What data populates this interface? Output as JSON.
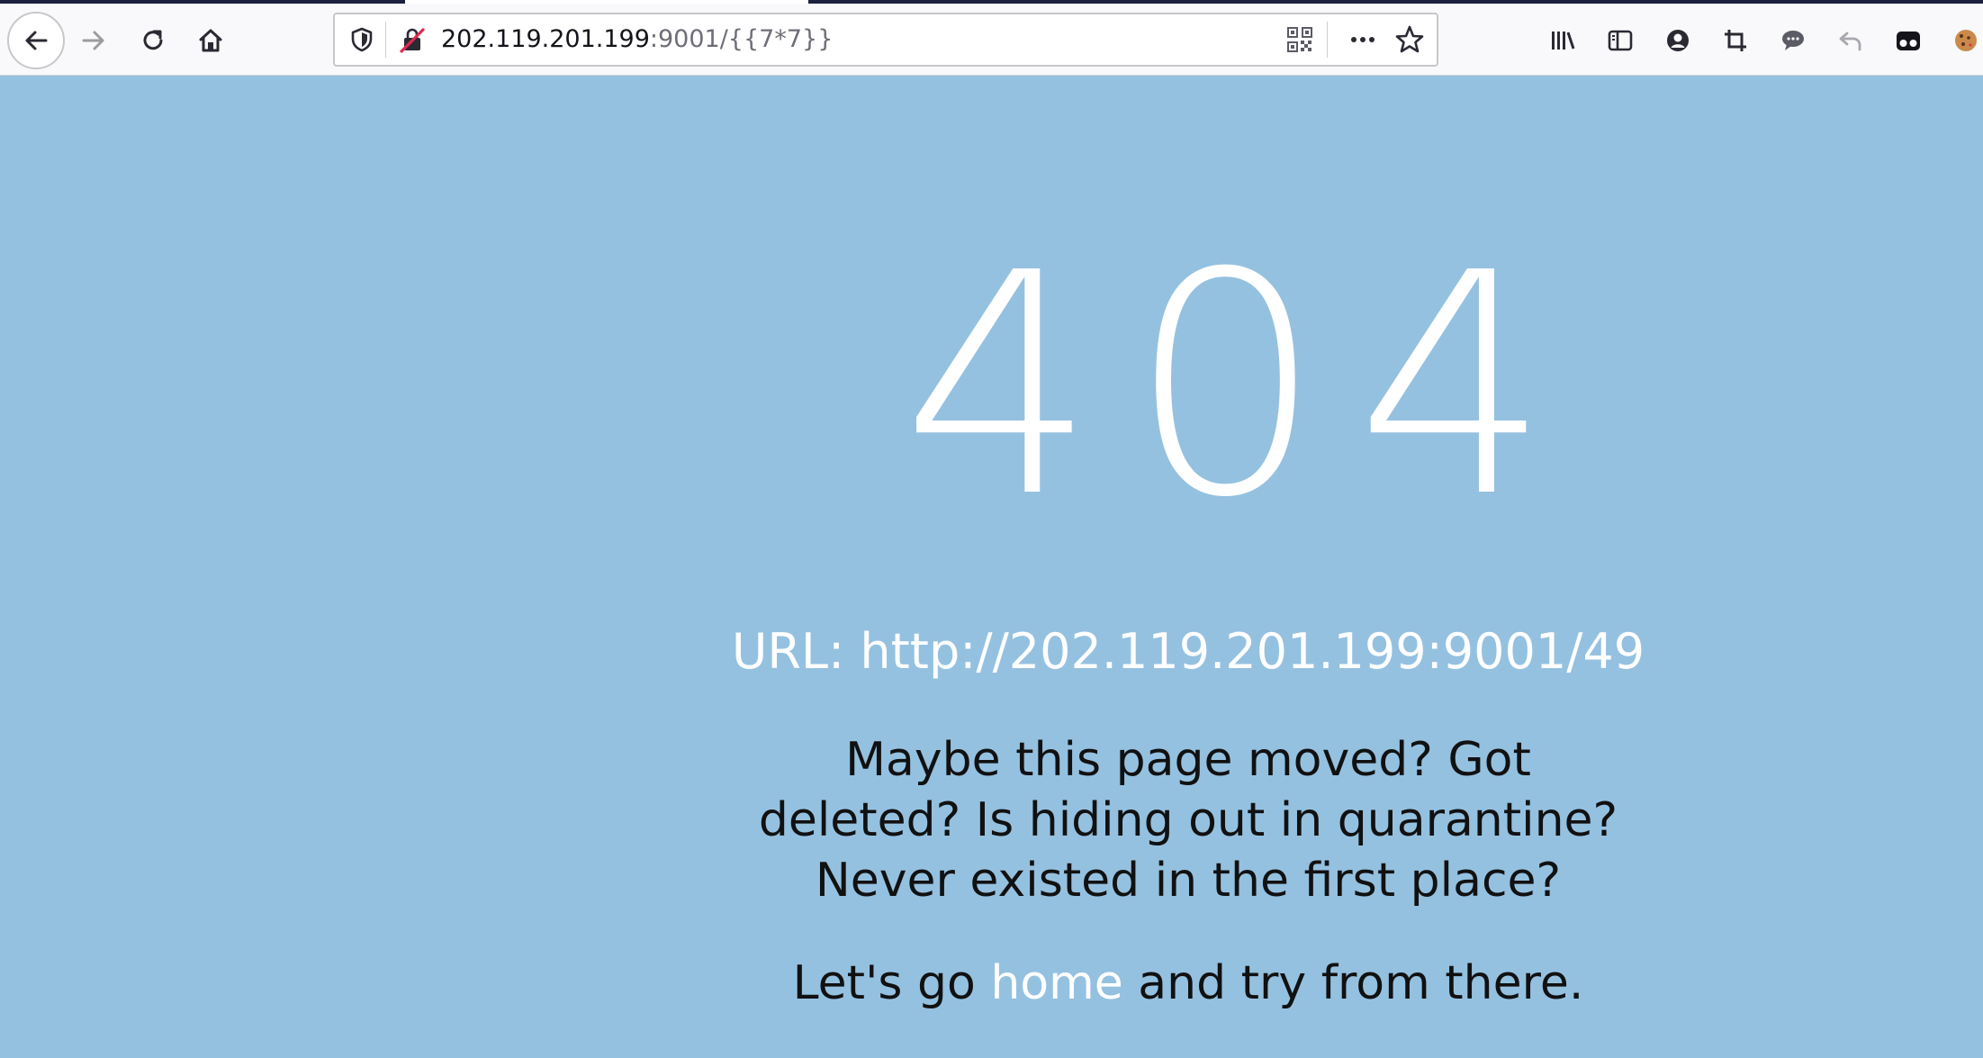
{
  "browser": {
    "url_host": "202.119.201.199",
    "url_path": ":9001/{{7*7}}",
    "icons": {
      "back": "back-arrow-icon",
      "forward": "forward-arrow-icon",
      "reload": "reload-icon",
      "home": "home-icon",
      "tracking": "shield-icon",
      "insecure": "insecure-lock-icon",
      "qr": "qr-code-icon",
      "more": "more-actions-icon",
      "bookmark": "bookmark-star-icon",
      "toolbar_right": [
        "library-icon",
        "sidebar-icon",
        "account-icon",
        "screenshot-icon",
        "chat-icon",
        "undo-icon",
        "extension-mask-icon",
        "cookie-icon"
      ]
    },
    "colors": {
      "toolbar_bg": "#f9f9fb",
      "page_bg": "#95c1e0",
      "insecure_red": "#e22850"
    }
  },
  "page": {
    "error_code": "404",
    "url_line": "URL: http://202.119.201.199:9001/49",
    "message": "Maybe this page moved? Got deleted? Is hiding out in quarantine? Never existed in the first place?",
    "home_prefix": "Let's go ",
    "home_link": "home",
    "home_suffix": " and try from there."
  }
}
